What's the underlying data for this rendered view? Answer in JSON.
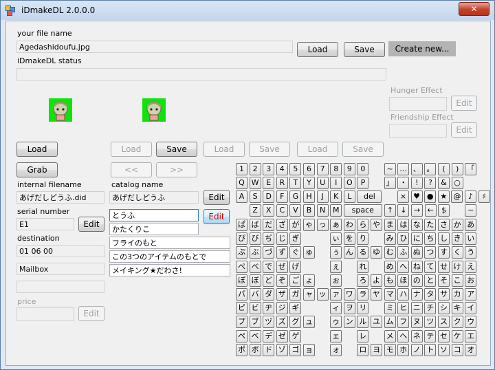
{
  "window": {
    "title": "iDmakeDL 2.0.0.0",
    "close": "✕"
  },
  "file": {
    "label": "your file name",
    "value": "Agedashidoufu.jpg",
    "load": "Load",
    "save": "Save",
    "create": "Create new..."
  },
  "status": {
    "label": "iDmakeDL status",
    "value": ""
  },
  "hunger": {
    "label": "Hunger Effect",
    "edit": "Edit",
    "value": ""
  },
  "friendship": {
    "label": "Friendship Effect",
    "edit": "Edit",
    "value": ""
  },
  "left": {
    "load": "Load",
    "grab": "Grab",
    "internal_label": "internal filename",
    "internal_value": "あげだしどうふ.did",
    "serial_label": "serial number",
    "serial_value": "E1",
    "serial_edit": "Edit",
    "dest_label": "destination",
    "dest_value": "01 06 00",
    "mailbox": "Mailbox",
    "price_label": "price",
    "price_value": "",
    "price_edit": "Edit"
  },
  "mid": {
    "load1": "Load",
    "save1": "Save",
    "load2": "Load",
    "save2": "Save",
    "load3": "Load",
    "save3": "Save",
    "prev": "<<",
    "next": ">>",
    "catalog_label": "catalog name",
    "catalog_value": "あげだしどうふ",
    "catalog_edit": "Edit",
    "item_edit": "Edit",
    "items": [
      "とうふ",
      "かたくりこ",
      "フライのもと",
      "この3つのアイテムのもとで",
      "メイキング★だわさ!"
    ]
  },
  "keyboard": {
    "row1": [
      "1",
      "2",
      "3",
      "4",
      "5",
      "6",
      "7",
      "8",
      "9",
      "0",
      "",
      "~",
      "…",
      "、",
      "。",
      "(",
      ")",
      "「"
    ],
    "row2": [
      "Q",
      "W",
      "E",
      "R",
      "T",
      "Y",
      "U",
      "I",
      "O",
      "P",
      "",
      "」",
      "・",
      "!",
      "?",
      "&",
      "○"
    ],
    "row3": [
      "A",
      "S",
      "D",
      "F",
      "G",
      "H",
      "J",
      "K",
      "L",
      "del",
      "",
      "×",
      "♥",
      "●",
      "★",
      "@",
      "♪",
      "♯"
    ],
    "row4": [
      "",
      "Z",
      "X",
      "C",
      "V",
      "B",
      "N",
      "M",
      "space",
      "↑",
      "↓",
      "→",
      "←",
      "$",
      "",
      "−"
    ],
    "kana": [
      [
        "ぱ",
        "ば",
        "だ",
        "ざ",
        "が",
        "ゃ",
        "っ",
        "ぁ",
        "わ",
        "ら",
        "や",
        "ま",
        "は",
        "な",
        "た",
        "さ",
        "か",
        "あ"
      ],
      [
        "ぴ",
        "び",
        "ぢ",
        "じ",
        "ぎ",
        "",
        "",
        "ぃ",
        "を",
        "り",
        "",
        "み",
        "ひ",
        "に",
        "ち",
        "し",
        "き",
        "い"
      ],
      [
        "ぷ",
        "ぶ",
        "づ",
        "ず",
        "ぐ",
        "ゅ",
        "",
        "ぅ",
        "ん",
        "る",
        "ゆ",
        "む",
        "ふ",
        "ぬ",
        "つ",
        "す",
        "く",
        "う"
      ],
      [
        "ぺ",
        "べ",
        "で",
        "ぜ",
        "げ",
        "",
        "",
        "ぇ",
        "",
        "れ",
        "",
        "め",
        "へ",
        "ね",
        "て",
        "せ",
        "け",
        "え"
      ],
      [
        "ぽ",
        "ぼ",
        "ど",
        "ぞ",
        "ご",
        "ょ",
        "",
        "ぉ",
        "",
        "ろ",
        "よ",
        "も",
        "ほ",
        "の",
        "と",
        "そ",
        "こ",
        "お"
      ],
      [
        "パ",
        "バ",
        "ダ",
        "ザ",
        "ガ",
        "ャ",
        "ッ",
        "ァ",
        "ワ",
        "ラ",
        "ヤ",
        "マ",
        "ハ",
        "ナ",
        "タ",
        "サ",
        "カ",
        "ア"
      ],
      [
        "ピ",
        "ビ",
        "ヂ",
        "ジ",
        "ギ",
        "",
        "",
        "ィ",
        "ヲ",
        "リ",
        "",
        "ミ",
        "ヒ",
        "ニ",
        "チ",
        "シ",
        "キ",
        "イ"
      ],
      [
        "プ",
        "ブ",
        "ヅ",
        "ズ",
        "グ",
        "ュ",
        "",
        "ゥ",
        "ン",
        "ル",
        "ユ",
        "ム",
        "フ",
        "ヌ",
        "ツ",
        "ス",
        "ク",
        "ウ"
      ],
      [
        "ペ",
        "ベ",
        "デ",
        "ゼ",
        "ゲ",
        "",
        "",
        "ェ",
        "",
        "レ",
        "",
        "メ",
        "ヘ",
        "ネ",
        "テ",
        "セ",
        "ケ",
        "エ"
      ],
      [
        "ポ",
        "ボ",
        "ド",
        "ゾ",
        "ゴ",
        "ョ",
        "",
        "ォ",
        "",
        "ロ",
        "ヨ",
        "モ",
        "ホ",
        "ノ",
        "ト",
        "ソ",
        "コ",
        "オ"
      ]
    ]
  }
}
